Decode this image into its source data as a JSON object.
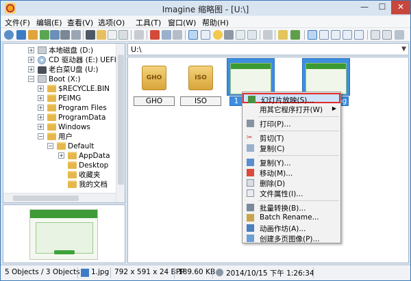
{
  "window": {
    "title": "Imagine 缩略图 - [U:\\]",
    "min_label": "—",
    "max_label": "☐",
    "close_label": "✕"
  },
  "menu": [
    "文件(F)",
    "编辑(E)",
    "查看(V)",
    "选项(O)",
    "工具(T)",
    "窗口(W)",
    "帮助(H)"
  ],
  "tree": {
    "items": [
      {
        "label": "本地磁盘 (D:)",
        "icon": "drive-icon"
      },
      {
        "label": "CD 驱动器 (E:) UEFI+B",
        "icon": "cd-icon"
      },
      {
        "label": "老白菜U盘 (U:)",
        "icon": "usb-drive-icon"
      },
      {
        "label": "Boot (X:)",
        "icon": "drive-icon"
      },
      {
        "label": "$RECYCLE.BIN",
        "icon": "folder-icon"
      },
      {
        "label": "PEIMG",
        "icon": "folder-icon"
      },
      {
        "label": "Program Files",
        "icon": "folder-icon"
      },
      {
        "label": "ProgramData",
        "icon": "folder-icon"
      },
      {
        "label": "Windows",
        "icon": "folder-icon"
      },
      {
        "label": "用户",
        "icon": "folder-icon"
      },
      {
        "label": "Default",
        "icon": "folder-icon"
      },
      {
        "label": "AppData",
        "icon": "folder-icon"
      },
      {
        "label": "Desktop",
        "icon": "folder-icon"
      },
      {
        "label": "收藏夹",
        "icon": "folder-icon"
      },
      {
        "label": "我的文档",
        "icon": "folder-icon"
      }
    ]
  },
  "address": {
    "value": "U:\\"
  },
  "thumbnails": [
    {
      "label": "GHO",
      "icon": "folder-icon",
      "folder_text": "GHO"
    },
    {
      "label": "ISO",
      "icon": "folder-icon",
      "folder_text": "ISO"
    },
    {
      "label": "1",
      "icon": "image-icon"
    },
    {
      "label": "jpg",
      "icon": "image-icon"
    }
  ],
  "context_menu": {
    "items": [
      {
        "label": "幻灯片放映(S)...",
        "icon": "slideshow-icon"
      },
      {
        "label": "用其它程序打开(W)",
        "icon": "open-with-icon"
      },
      {
        "label": "打印(P)...",
        "icon": "print-icon"
      },
      {
        "label": "剪切(T)",
        "icon": "cut-icon"
      },
      {
        "label": "复制(C)",
        "icon": "copy-icon"
      },
      {
        "label": "复制(Y)...",
        "icon": "copy-to-icon"
      },
      {
        "label": "移动(M)...",
        "icon": "move-icon"
      },
      {
        "label": "删除(D)",
        "icon": "delete-icon"
      },
      {
        "label": "文件属性(I)...",
        "icon": "properties-icon"
      },
      {
        "label": "批量转换(B)...",
        "icon": "batch-convert-icon"
      },
      {
        "label": "Batch Rename...",
        "icon": "batch-rename-icon"
      },
      {
        "label": "动画作坊(A)...",
        "icon": "animation-icon"
      },
      {
        "label": "创建多页图像(P)...",
        "icon": "multipage-icon"
      }
    ],
    "submenu_arrow": "▶"
  },
  "status": {
    "objects": "5 Objects / 3 Objects",
    "file": "1.jpg",
    "dimensions": "792 x 591 x 24 BPP",
    "size": "189.60 KB",
    "date": "2014/10/15 下午 1:26:34"
  },
  "colors": {
    "selection": "#3d8ee0",
    "highlight_border": "#e02a2a"
  }
}
